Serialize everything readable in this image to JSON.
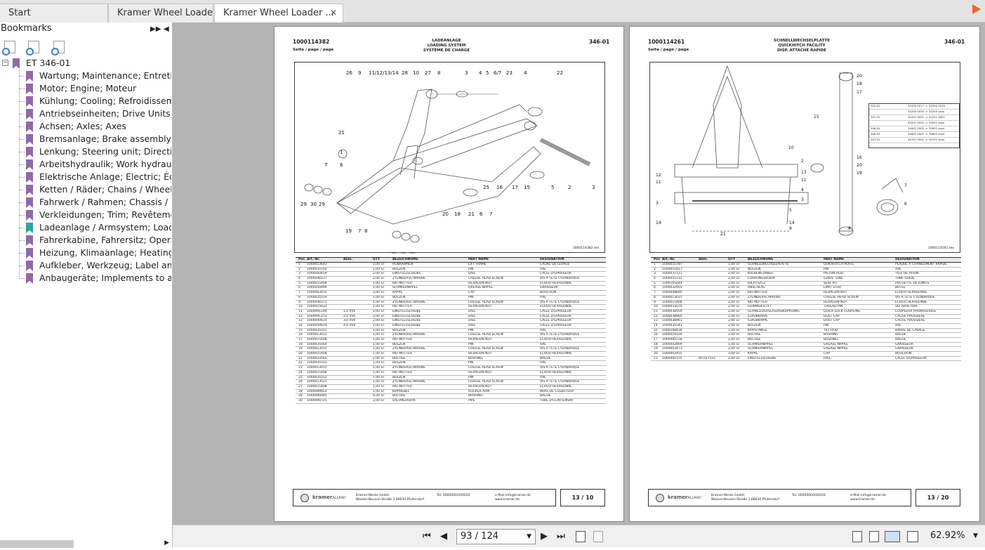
{
  "tabs": [
    {
      "label": "Start"
    },
    {
      "label": "Kramer Wheel Loader ..."
    },
    {
      "label": "Kramer Wheel Loader ...",
      "close": "✕"
    }
  ],
  "sidebar": {
    "title": "Bookmarks",
    "root": "ET 346-01",
    "items": [
      {
        "label": "Wartung; Maintenance; Entretien"
      },
      {
        "label": "Motor; Engine; Moteur"
      },
      {
        "label": "Kühlung; Cooling; Refroidissement"
      },
      {
        "label": "Antriebseinheiten; Drive Units; Uni"
      },
      {
        "label": "Achsen; Axles; Axes"
      },
      {
        "label": "Bremsanlage; Brake assembly; Syst"
      },
      {
        "label": "Lenkung; Steering unit; Direction"
      },
      {
        "label": "Arbeitshydraulik; Work hydraulics; I"
      },
      {
        "label": "Elektrische Anlage; Electric; Équipe"
      },
      {
        "label": "Ketten / Räder; Chains / Wheels; C"
      },
      {
        "label": "Fahrwerk / Rahmen; Chassis / Fram"
      },
      {
        "label": "Verkleidungen; Trim; Revêtement"
      },
      {
        "label": "Ladeanlage / Armsystem; Loader u",
        "active": true
      },
      {
        "label": "Fahrerkabine, Fahrersitz; Operator'"
      },
      {
        "label": "Heizung, Klimaanlage; Heating, Air"
      },
      {
        "label": "Aufkleber, Werkzeug; Label and to"
      },
      {
        "label": "Anbaugeräte; Implements to attac"
      }
    ]
  },
  "page1": {
    "number": "1000114382",
    "seite": "Seite / page / page",
    "title": [
      "LADEANLAGE",
      "LOADING SYSTEM",
      "SYSTÈME DE CHARGE"
    ],
    "code": "346-01",
    "drawing_id": "1000114382.tex",
    "table_headers": [
      "Pos",
      "Art.-Nr.",
      "Abm.",
      "QTY",
      "BEZEICHNUNG",
      "PART NAME",
      "DESIGNATION"
    ],
    "rows": [
      [
        "1",
        "1000053643",
        "",
        "1,00 ST",
        "HUBRAHMEN",
        "LIFT FRAME",
        "CADRE DE LEVAGE"
      ],
      [
        "2",
        "1000035550",
        "",
        "1,00 ST",
        "BOLZEN",
        "PIN",
        "AXE"
      ],
      [
        "3",
        "1000060659",
        "",
        "2,00 ST",
        "EINSTELLSCHEIBE",
        "DISC",
        "CALLE D'ÉPAISSEUR"
      ],
      [
        "4",
        "1000048137",
        "",
        "2,00 ST",
        "ZYLINDERSCHRAUBE",
        "CHEESE HEAD SCREW",
        "VIS À TÊTE CYLINDRIQUE"
      ],
      [
        "5",
        "1000015408",
        "",
        "2,00 ST",
        "6KT-MUTTER",
        "HEXAGON NUT",
        "ÉCROU HEXAGONAL"
      ],
      [
        "6",
        "1000050469",
        "",
        "2,00 ST",
        "SCHMIERNIPPEL",
        "GREASE NIPPLE",
        "GRAISSEUR"
      ],
      [
        "7",
        "1000003455",
        "",
        "2,00 ST",
        "KAPPE",
        "CAP",
        "BOUCHON"
      ],
      [
        "8",
        "1000035550",
        "",
        "1,00 ST",
        "BOLZEN",
        "PIN",
        "AXE"
      ],
      [
        "9",
        "1000048175",
        "",
        "1,00 ST",
        "ZYLINDERSCHRAUBE",
        "CHEESE HEAD SCREW",
        "VIS À TÊTE CYLINDRIQUE"
      ],
      [
        "10",
        "1000015633",
        "",
        "1,00 ST",
        "6KT-MUTTER",
        "HEXAGON NUT",
        "ÉCROU HEXAGONAL"
      ],
      [
        "11",
        "1000091149",
        "1,0 mm",
        "2,00 ST",
        "EINSTELLSCHEIBE",
        "DISC",
        "CALLE D'ÉPAISSEUR"
      ],
      [
        "12",
        "1000091153",
        "2,0 mm",
        "2,00 ST",
        "EINSTELLSCHEIBE",
        "DISC",
        "CALLE D'ÉPAISSEUR"
      ],
      [
        "13",
        "1000040610",
        "3,0 mm",
        "2,00 ST",
        "EINSTELLSCHEIBE",
        "DISC",
        "CALLE D'ÉPAISSEUR"
      ],
      [
        "14",
        "1000040619",
        "4,0 mm",
        "2,00 ST",
        "EINSTELLSCHEIBE",
        "DISC",
        "CALLE D'ÉPAISSEUR"
      ],
      [
        "15",
        "1000035555",
        "",
        "1,00 ST",
        "BOLZEN",
        "PIN",
        "AXE"
      ],
      [
        "16",
        "1000013015",
        "",
        "1,00 ST",
        "ZYLINDERSCHRAUBE",
        "CHEESE HEAD SCREW",
        "VIS À TÊTE CYLINDRIQUE"
      ],
      [
        "17",
        "1000015408",
        "",
        "1,00 ST",
        "6KT-MUTTER",
        "HEXAGON NUT",
        "ÉCROU HEXAGONAL"
      ],
      [
        "18",
        "1000035564",
        "",
        "1,00 ST",
        "BOLZEN",
        "PIN",
        "AXE"
      ],
      [
        "19",
        "1000013015",
        "",
        "1,00 ST",
        "ZYLINDERSCHRAUBE",
        "CHEESE HEAD SCREW",
        "VIS À TÊTE CYLINDRIQUE"
      ],
      [
        "20",
        "1000015408",
        "",
        "1,00 ST",
        "6KT-MUTTER",
        "HEXAGON NUT",
        "ÉCROU HEXAGONAL"
      ],
      [
        "21",
        "1000023565",
        "",
        "2,00 ST",
        "BUCHSE",
        "BUSHING",
        "BAGUE"
      ],
      [
        "22",
        "1000035555",
        "",
        "1,00 ST",
        "BOLZEN",
        "PIN",
        "AXE"
      ],
      [
        "23",
        "1000013015",
        "",
        "1,00 ST",
        "ZYLINDERSCHRAUBE",
        "CHEESE HEAD SCREW",
        "VIS À TÊTE CYLINDRIQUE"
      ],
      [
        "24",
        "1000015408",
        "",
        "1,00 ST",
        "6KT-MUTTER",
        "HEXAGON NUT",
        "ÉCROU HEXAGONAL"
      ],
      [
        "25",
        "1000035552",
        "",
        "1,00 ST",
        "BOLZEN",
        "PIN",
        "AXE"
      ],
      [
        "26",
        "1000013015",
        "",
        "1,00 ST",
        "ZYLINDERSCHRAUBE",
        "CHEESE HEAD SCREW",
        "VIS À TÊTE CYLINDRIQUE"
      ],
      [
        "27",
        "1000015408",
        "",
        "1,00 ST",
        "6KT-MUTTER",
        "HEXAGON NUT",
        "ÉCROU HEXAGONAL"
      ],
      [
        "28",
        "1000089603",
        "",
        "1,00 ST",
        "KIPPHEBEL",
        "ROCKER ARM",
        "BRAS DE CULBUTEUR"
      ],
      [
        "29",
        "1000090085",
        "",
        "4,00 ST",
        "BUCHSE",
        "BUSHING",
        "BAGUE"
      ],
      [
        "30",
        "1000090725",
        "",
        "2,00 ST",
        "DISTANZROHR",
        "PIPE",
        "TUBE D'ÉCARTEMENT"
      ]
    ],
    "company": [
      "Kramer-Werke GmbH",
      "Wacker-Neuson-Straße 1  88630 Pfullendorf"
    ],
    "tel": "Tel. 0000000/200020",
    "mail": [
      "e-Mail:info@kramer.de",
      "www.kramer.de"
    ],
    "pageno": "13 / 10"
  },
  "page2": {
    "number": "1000114261",
    "seite": "Seite / page / page",
    "title": [
      "SCHNELLWECHSELPLATTE",
      "QUICKHITCH FACILITY",
      "DISP. ATTACHE RAPIDE"
    ],
    "code": "346-01",
    "drawing_id": "1000114261.tex",
    "table_headers": [
      "Pos",
      "Art.-Nr.",
      "Abm.",
      "QTY",
      "BEZEICHNUNG",
      "PART NAME",
      "DESIGNATION"
    ],
    "rows": [
      [
        "1",
        "1000051787",
        "",
        "1,00 ST",
        "SCHNELLWECHSELPLATTE",
        "QUICKHITCH PLATE",
        "PLAQUE À CHANGEMENT RAPIDE"
      ],
      [
        "2",
        "1000051817",
        "",
        "1,00 ST",
        "BOLZEN",
        "PIN",
        "AXE"
      ],
      [
        "3",
        "1000037123",
        "",
        "2,00 ST",
        "KOLBENSTANGE",
        "PISTON ROD",
        "TIGE DE VÉRIN"
      ],
      [
        "4",
        "1000051112",
        "",
        "2,00 ST",
        "FÜHRUNGSROHR",
        "GUIDE TUBE",
        "TUBE GUIDE"
      ],
      [
        "5",
        "1000105444",
        "",
        "2,00 ST",
        "DICHTSATZ",
        "SEAL KIT",
        "POCHETTE DE JOINTS"
      ],
      [
        "6",
        "1000032955",
        "",
        "2,00 ST",
        "ANSCHLAG",
        "LIMIT STOP",
        "BUTÉE"
      ],
      [
        "7",
        "1000048646",
        "",
        "2,00 ST",
        "6KT-MUTTER",
        "HEXAGON NUT",
        "ÉCROU HEXAGONAL"
      ],
      [
        "8",
        "1000013015",
        "",
        "2,00 ST",
        "ZYLINDERSCHRAUBE",
        "CHEESE HEAD SCREW",
        "VIS À TÊTE CYLINDRIQUE"
      ],
      [
        "9",
        "1000015408",
        "",
        "2,00 ST",
        "6KT-MUTTER",
        "HEXAGON NUT",
        "ÉCROU HEXAGONAL"
      ],
      [
        "10",
        "1000033070",
        "",
        "2,00 ST",
        "GEWINDESTIFT",
        "THREAD PIN",
        "VIS ARRÊTOIR"
      ],
      [
        "11",
        "1000038959",
        "",
        "2,00 ST",
        "SCHNELLVERSCHLUSSKUPPLUNG",
        "QUICK LOCK COUPLING",
        "COUPLEUR HYDRAULIQUE"
      ],
      [
        "12",
        "1000038960",
        "",
        "2,00 ST",
        "STAUBKAPPE",
        "DUST CAP",
        "CACHE POUSSIÈRE"
      ],
      [
        "13",
        "1000038961",
        "",
        "2,00 ST",
        "STAUBKAPPE",
        "DUST CAP",
        "CACHE POUSSIÈRE"
      ],
      [
        "14",
        "1000035541",
        "",
        "2,00 ST",
        "BOLZEN",
        "PIN",
        "AXE"
      ],
      [
        "15",
        "1000108438",
        "",
        "1,00 ST",
        "KIPPSTANGE",
        "TILT ROD",
        "BARRE DE CAVAGE"
      ],
      [
        "16",
        "1000019229",
        "",
        "2,00 ST",
        "BUCHSE",
        "BUSHING",
        "BAGUE"
      ],
      [
        "17",
        "1000090728",
        "",
        "2,00 ST",
        "BUCHSE",
        "BUSHING",
        "BAGUE"
      ],
      [
        "18",
        "1000003469",
        "",
        "1,00 ST",
        "SCHMIERNIPPEL",
        "GREASE NIPPLE",
        "GRAISSEUR"
      ],
      [
        "19",
        "1000003471",
        "",
        "2,00 ST",
        "SCHMIERNIPPEL",
        "GREASE NIPPLE",
        "GRAISSEUR"
      ],
      [
        "20",
        "1000003455",
        "",
        "3,00 ST",
        "KAPPE",
        "CAP",
        "BOUCHON"
      ],
      [
        "21",
        "1000091155",
        "40,5x75x2",
        "2,00 ST",
        "EINSTELLSCHEIBE",
        "DISC",
        "CALLE D'ÉPAISSEUR"
      ]
    ],
    "serials": [
      [
        "342-01",
        "34200 0017 -> 34200 0018"
      ],
      [
        "",
        "34200 0035 -> 34200 xxxx"
      ],
      [
        "342-01",
        "34201 0020 -> 34201 0001"
      ],
      [
        "",
        "34201 0034 -> 34201 xxxx"
      ],
      [
        "346-01",
        "34601 0001 -> 34601 xxxx"
      ],
      [
        "346-03",
        "34602 0001 -> 34602 xxxx"
      ],
      [
        "347-01",
        "34701 0001 -> 34701 xxxx"
      ]
    ],
    "company": [
      "Kramer-Werke GmbH",
      "Wacker-Neuson-Straße 1  88630 Pfullendorf"
    ],
    "tel": "Tel. 0000000/200020",
    "mail": [
      "e-Mail:info@kramer.de",
      "www.kramer.de"
    ],
    "pageno": "13 / 20"
  },
  "logo": {
    "brand": "kramer",
    "sub": "ALLRAD"
  },
  "statusbar": {
    "page": "93 / 124",
    "zoom": "62.92%"
  },
  "colors": {
    "bookmark": "#8e6aa8",
    "bookmark_active": "#2fa39b",
    "accent": "#e8672a"
  }
}
